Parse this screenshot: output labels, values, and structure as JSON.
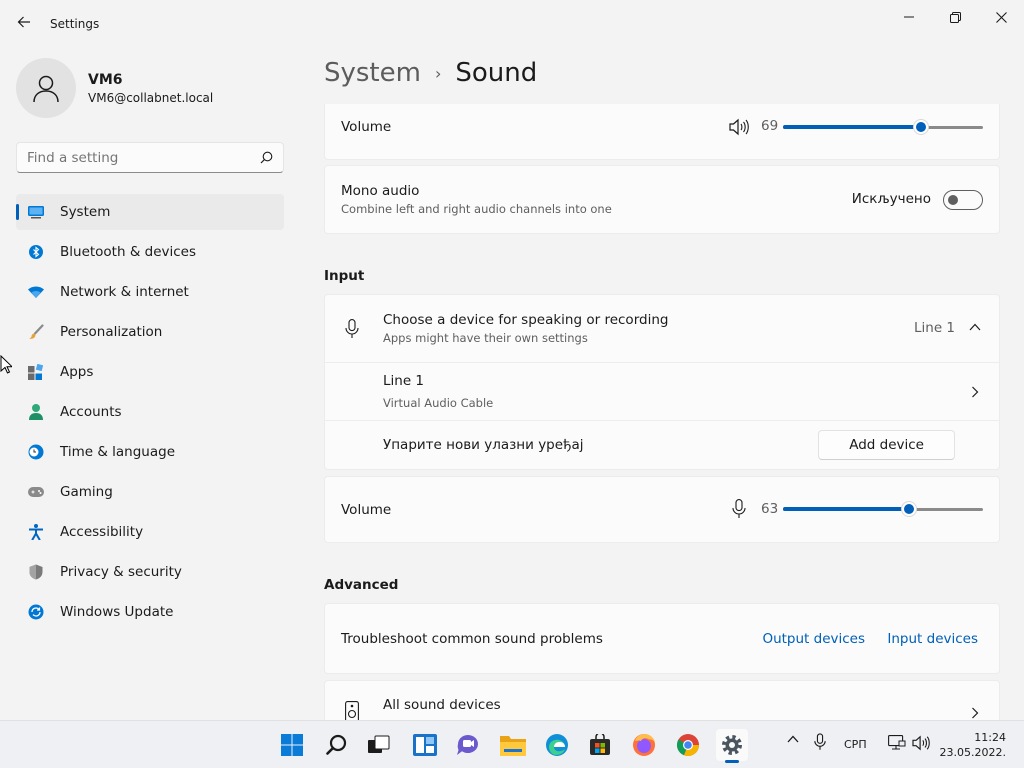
{
  "app": {
    "title": "Settings"
  },
  "profile": {
    "name": "VM6",
    "email": "VM6@collabnet.local"
  },
  "search": {
    "placeholder": "Find a setting"
  },
  "nav": [
    {
      "label": "System",
      "icon": "system-icon",
      "active": true
    },
    {
      "label": "Bluetooth & devices",
      "icon": "bluetooth-icon"
    },
    {
      "label": "Network & internet",
      "icon": "wifi-icon"
    },
    {
      "label": "Personalization",
      "icon": "brush-icon"
    },
    {
      "label": "Apps",
      "icon": "apps-icon"
    },
    {
      "label": "Accounts",
      "icon": "person-icon"
    },
    {
      "label": "Time & language",
      "icon": "clock-globe-icon"
    },
    {
      "label": "Gaming",
      "icon": "gamepad-icon"
    },
    {
      "label": "Accessibility",
      "icon": "accessibility-icon"
    },
    {
      "label": "Privacy & security",
      "icon": "shield-icon"
    },
    {
      "label": "Windows Update",
      "icon": "update-icon"
    }
  ],
  "breadcrumb": {
    "parent": "System",
    "separator": "›",
    "current": "Sound"
  },
  "output": {
    "volume_label": "Volume",
    "volume_value": "69",
    "volume_fraction": 0.69,
    "mono_title": "Mono audio",
    "mono_subtitle": "Combine left and right audio channels into one",
    "mono_state": "Искључено",
    "mono_on": false
  },
  "input": {
    "section_title": "Input",
    "choose_title": "Choose a device for speaking or recording",
    "choose_subtitle": "Apps might have their own settings",
    "selected_device": "Line 1",
    "device_name": "Line 1",
    "device_subtitle": "Virtual Audio Cable",
    "pair_label": "Упарите нови улазни уређај",
    "add_device": "Add device",
    "volume_label": "Volume",
    "volume_value": "63",
    "volume_fraction": 0.63
  },
  "advanced": {
    "section_title": "Advanced",
    "troubleshoot_label": "Troubleshoot common sound problems",
    "output_link": "Output devices",
    "input_link": "Input devices",
    "all_devices": "All sound devices"
  },
  "taskbar": {
    "icons": [
      "windows-start-icon",
      "search-icon",
      "task-view-icon",
      "widgets-icon",
      "chat-icon",
      "file-explorer-icon",
      "edge-icon",
      "store-icon",
      "firefox-icon",
      "chrome-icon",
      "settings-icon"
    ],
    "language": "СРП",
    "time": "11:24",
    "date": "23.05.2022."
  },
  "colors": {
    "accent": "#005fb8",
    "background": "#f3f3f3",
    "card": "#fbfbfb"
  }
}
